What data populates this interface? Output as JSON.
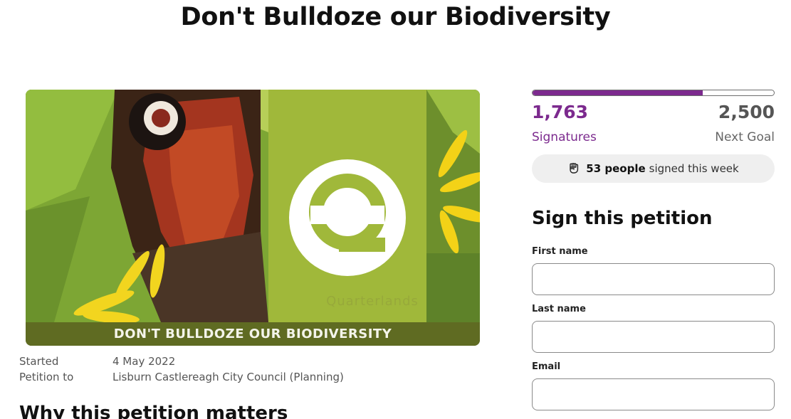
{
  "page": {
    "title": "Don't Bulldoze our Biodiversity"
  },
  "hero": {
    "logo_text": "Quarterlands",
    "banner_text": "DON'T BULLDOZE OUR BIODIVERSITY"
  },
  "meta": {
    "started_label": "Started",
    "started_value": "4 May 2022",
    "petition_to_label": "Petition to",
    "petition_to_value": "Lisburn Castlereagh City Council (Planning)"
  },
  "section": {
    "heading": "Why this petition matters"
  },
  "progress": {
    "signatures": "1,763",
    "signatures_label": "Signatures",
    "goal": "2,500",
    "goal_label": "Next Goal",
    "fraction": 0.705
  },
  "weekly": {
    "icon": "raised-fist-icon",
    "count": "53 people",
    "text": "signed this week"
  },
  "sign_form": {
    "heading": "Sign this petition",
    "first_name_label": "First name",
    "last_name_label": "Last name",
    "email_label": "Email"
  },
  "colors": {
    "accent": "#7c2a8e",
    "banner": "#5f6b22",
    "logo_green": "#97a93a"
  }
}
